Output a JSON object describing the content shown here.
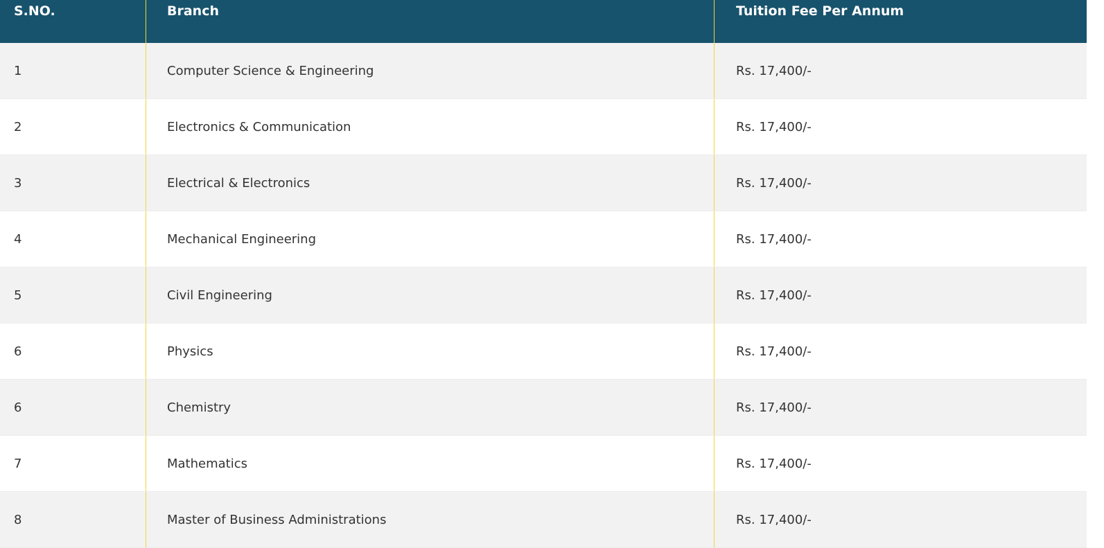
{
  "table": {
    "headers": [
      "S.NO.",
      "Branch",
      "Tuition Fee Per Annum"
    ],
    "rows": [
      {
        "sno": "1",
        "branch": "Computer Science & Engineering",
        "fee": "Rs. 17,400/-"
      },
      {
        "sno": "2",
        "branch": "Electronics & Communication",
        "fee": "Rs. 17,400/-"
      },
      {
        "sno": "3",
        "branch": "Electrical & Electronics",
        "fee": "Rs. 17,400/-"
      },
      {
        "sno": "4",
        "branch": "Mechanical Engineering",
        "fee": "Rs. 17,400/-"
      },
      {
        "sno": "5",
        "branch": "Civil Engineering",
        "fee": "Rs. 17,400/-"
      },
      {
        "sno": "6",
        "branch": "Physics",
        "fee": "Rs. 17,400/-"
      },
      {
        "sno": "6",
        "branch": "Chemistry",
        "fee": "Rs. 17,400/-"
      },
      {
        "sno": "7",
        "branch": "Mathematics",
        "fee": "Rs. 17,400/-"
      },
      {
        "sno": "8",
        "branch": "Master of Business Administrations",
        "fee": "Rs. 17,400/-"
      }
    ]
  },
  "colors": {
    "header_bg": "#18536d",
    "divider": "#f2d43a",
    "row_alt": "#f2f2f2"
  }
}
